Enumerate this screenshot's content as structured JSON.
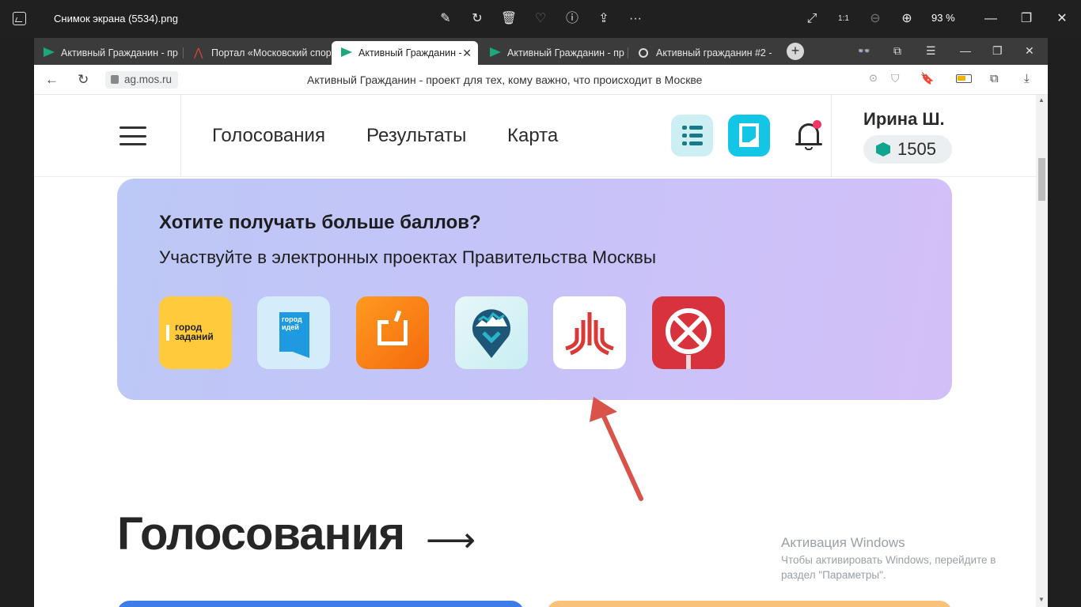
{
  "viewer": {
    "file_title": "Снимок экрана (5534).png",
    "zoom": "93 %",
    "icons": [
      "edit-icon",
      "rotate-icon",
      "delete-icon",
      "favorite-icon",
      "info-icon",
      "share-icon",
      "more-icon",
      "fullscreen-icon",
      "actual-size-icon",
      "zoom-out-icon",
      "zoom-in-icon"
    ]
  },
  "browser": {
    "tabs": [
      {
        "label": "Активный Гражданин - пр",
        "active": false
      },
      {
        "label": "Портал «Московский спор",
        "active": false
      },
      {
        "label": "Активный Гражданин -",
        "active": true
      },
      {
        "label": "Активный Гражданин - пр",
        "active": false
      },
      {
        "label": "Активный гражданин #2 -",
        "active": false
      }
    ],
    "url": "ag.mos.ru",
    "page_title": "Активный Гражданин - проект для тех, кому важно, что происходит в Москве"
  },
  "site": {
    "nav": [
      "Голосования",
      "Результаты",
      "Карта"
    ],
    "user_name": "Ирина Ш.",
    "points": "1505"
  },
  "promo": {
    "title": "Хотите получать больше баллов?",
    "subtitle": "Участвуйте в электронных проектах Правительства Москвы",
    "apps": [
      {
        "name": "gorod-zadaniy",
        "text": "город заданий"
      },
      {
        "name": "gorod-idey",
        "text": "город идей"
      },
      {
        "name": "orange-app",
        "text": ""
      },
      {
        "name": "map-pin-app",
        "text": ""
      },
      {
        "name": "red-symbol-app",
        "text": ""
      },
      {
        "name": "no-sign-app",
        "text": ""
      }
    ]
  },
  "section": {
    "title": "Голосования",
    "arrow": "⟶"
  },
  "watermark": {
    "line1": "Активация Windows",
    "line2": "Чтобы активировать Windows, перейдите в раздел \"Параметры\"."
  },
  "colors": {
    "accent_teal": "#14c6e6",
    "brand_green": "#1aa87e",
    "notification_dot": "#f03566",
    "annotation_arrow": "#d9534a"
  }
}
